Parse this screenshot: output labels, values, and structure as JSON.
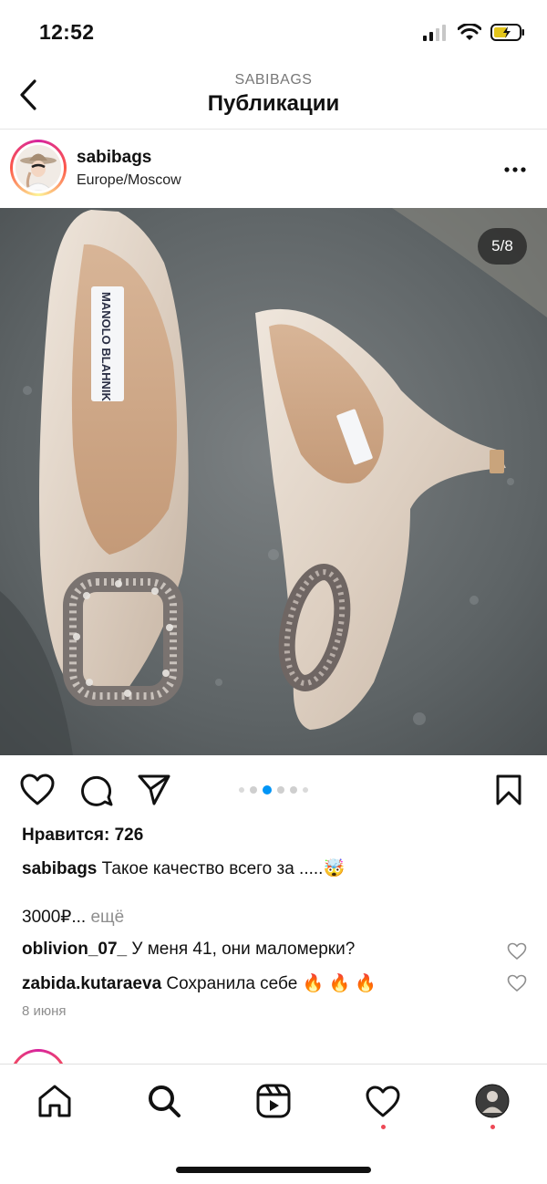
{
  "status": {
    "time": "12:52"
  },
  "header": {
    "account": "SABIBAGS",
    "title": "Публикации"
  },
  "post": {
    "username": "sabibags",
    "location": "Europe/Moscow",
    "counter": "5/8",
    "current_slide": 5,
    "total_slides": 8,
    "likes": "Нравится: 726",
    "caption_user": "sabibags",
    "caption_text": "Такое качество всего за .....🤯",
    "price_line": "3000₽...",
    "more_label": "ещё",
    "comments": [
      {
        "user": "oblivion_07_",
        "text": "У меня 41, они маломерки?"
      },
      {
        "user": "zabida.kutaraeva",
        "text": "Сохранила себе 🔥 🔥 🔥"
      }
    ],
    "date": "8 июня",
    "image_brand_label": "MANOLO BLAHNIK"
  },
  "colors": {
    "accent": "#0095f6",
    "notification": "#ed4956",
    "muted": "#8e8e8e"
  },
  "icons": {
    "back": "chevron-left-icon",
    "more": "more-horizontal-icon",
    "like": "heart-icon",
    "comment": "comment-icon",
    "share": "paper-plane-icon",
    "save": "bookmark-icon",
    "home": "home-icon",
    "search": "search-icon",
    "reels": "reels-icon",
    "activity": "heart-icon",
    "profile": "profile-avatar"
  }
}
